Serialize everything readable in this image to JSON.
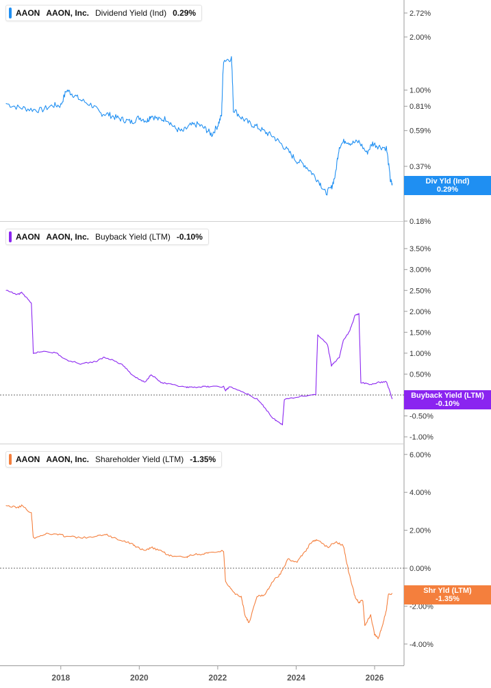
{
  "colors": {
    "div": "#1f8ff2",
    "buyback": "#8a24f0",
    "shareholder": "#f47f3d",
    "grid": "#d0d0d0",
    "axis": "#999999"
  },
  "panels": [
    {
      "ticker": "AAON",
      "company": "AAON, Inc.",
      "metric": "Dividend Yield (Ind)",
      "value": "0.29%",
      "badge_line1": "Div Yld (Ind)",
      "badge_line2": "0.29%"
    },
    {
      "ticker": "AAON",
      "company": "AAON, Inc.",
      "metric": "Buyback Yield (LTM)",
      "value": "-0.10%",
      "badge_line1": "Buyback Yield (LTM)",
      "badge_line2": "-0.10%"
    },
    {
      "ticker": "AAON",
      "company": "AAON, Inc.",
      "metric": "Shareholder Yield (LTM)",
      "value": "-1.35%",
      "badge_line1": "Shr Yld (LTM)",
      "badge_line2": "-1.35%"
    }
  ],
  "x_ticks": [
    "2018",
    "2020",
    "2022",
    "2024",
    "2026"
  ],
  "chart_data": [
    {
      "type": "line",
      "series": [
        {
          "name": "Dividend Yield (Ind)",
          "color": "#1f8ff2"
        }
      ],
      "y_scale": "log",
      "y_ticks": [
        "2.72%",
        "2.00%",
        "1.00%",
        "0.81%",
        "0.59%",
        "0.37%",
        "0.18%"
      ],
      "ylim": [
        0.18,
        2.72
      ],
      "points": [
        [
          2016.6,
          0.84
        ],
        [
          2016.9,
          0.8
        ],
        [
          2017.2,
          0.78
        ],
        [
          2017.5,
          0.77
        ],
        [
          2017.8,
          0.82
        ],
        [
          2018.0,
          0.82
        ],
        [
          2018.15,
          1.0
        ],
        [
          2018.3,
          0.95
        ],
        [
          2018.5,
          0.88
        ],
        [
          2018.8,
          0.82
        ],
        [
          2019.0,
          0.74
        ],
        [
          2019.2,
          0.73
        ],
        [
          2019.4,
          0.7
        ],
        [
          2019.6,
          0.68
        ],
        [
          2019.8,
          0.66
        ],
        [
          2020.0,
          0.7
        ],
        [
          2020.2,
          0.67
        ],
        [
          2020.3,
          0.72
        ],
        [
          2020.5,
          0.68
        ],
        [
          2020.7,
          0.69
        ],
        [
          2020.9,
          0.61
        ],
        [
          2021.1,
          0.58
        ],
        [
          2021.3,
          0.63
        ],
        [
          2021.5,
          0.64
        ],
        [
          2021.7,
          0.6
        ],
        [
          2021.85,
          0.56
        ],
        [
          2022.0,
          0.63
        ],
        [
          2022.1,
          0.72
        ],
        [
          2022.15,
          1.47
        ],
        [
          2022.35,
          1.52
        ],
        [
          2022.4,
          0.78
        ],
        [
          2022.6,
          0.7
        ],
        [
          2022.8,
          0.65
        ],
        [
          2023.0,
          0.62
        ],
        [
          2023.2,
          0.58
        ],
        [
          2023.4,
          0.55
        ],
        [
          2023.6,
          0.5
        ],
        [
          2023.8,
          0.45
        ],
        [
          2024.0,
          0.4
        ],
        [
          2024.2,
          0.38
        ],
        [
          2024.4,
          0.34
        ],
        [
          2024.6,
          0.3
        ],
        [
          2024.75,
          0.26
        ],
        [
          2024.9,
          0.28
        ],
        [
          2025.0,
          0.33
        ],
        [
          2025.1,
          0.48
        ],
        [
          2025.25,
          0.52
        ],
        [
          2025.4,
          0.5
        ],
        [
          2025.6,
          0.51
        ],
        [
          2025.8,
          0.44
        ],
        [
          2025.95,
          0.5
        ],
        [
          2026.1,
          0.48
        ],
        [
          2026.3,
          0.47
        ],
        [
          2026.4,
          0.31
        ],
        [
          2026.45,
          0.29
        ]
      ]
    },
    {
      "type": "line",
      "series": [
        {
          "name": "Buyback Yield (LTM)",
          "color": "#8a24f0"
        }
      ],
      "y_ticks": [
        "3.50%",
        "3.00%",
        "2.50%",
        "2.00%",
        "1.50%",
        "1.00%",
        "0.50%",
        "-0.50%",
        "-1.00%"
      ],
      "ylim": [
        -1.0,
        3.5
      ],
      "points": [
        [
          2016.6,
          2.5
        ],
        [
          2016.9,
          2.4
        ],
        [
          2017.0,
          2.45
        ],
        [
          2017.25,
          2.2
        ],
        [
          2017.3,
          1.0
        ],
        [
          2017.6,
          1.05
        ],
        [
          2017.9,
          1.0
        ],
        [
          2018.1,
          0.85
        ],
        [
          2018.5,
          0.75
        ],
        [
          2018.9,
          0.8
        ],
        [
          2019.1,
          0.9
        ],
        [
          2019.3,
          0.85
        ],
        [
          2019.6,
          0.7
        ],
        [
          2019.8,
          0.5
        ],
        [
          2019.95,
          0.4
        ],
        [
          2020.15,
          0.3
        ],
        [
          2020.3,
          0.5
        ],
        [
          2020.55,
          0.3
        ],
        [
          2020.8,
          0.25
        ],
        [
          2021.2,
          0.18
        ],
        [
          2021.3,
          0.18
        ],
        [
          2021.6,
          0.2
        ],
        [
          2021.8,
          0.2
        ],
        [
          2022.15,
          0.2
        ],
        [
          2022.2,
          0.1
        ],
        [
          2022.3,
          0.2
        ],
        [
          2022.7,
          0.05
        ],
        [
          2023.0,
          -0.1
        ],
        [
          2023.2,
          -0.3
        ],
        [
          2023.4,
          -0.55
        ],
        [
          2023.55,
          -0.65
        ],
        [
          2023.65,
          -0.7
        ],
        [
          2023.7,
          -0.1
        ],
        [
          2024.0,
          -0.05
        ],
        [
          2024.5,
          0.02
        ],
        [
          2024.55,
          1.45
        ],
        [
          2024.8,
          1.2
        ],
        [
          2024.9,
          0.7
        ],
        [
          2025.1,
          0.9
        ],
        [
          2025.2,
          1.3
        ],
        [
          2025.35,
          1.5
        ],
        [
          2025.5,
          1.9
        ],
        [
          2025.6,
          1.95
        ],
        [
          2025.65,
          0.3
        ],
        [
          2025.9,
          0.25
        ],
        [
          2026.1,
          0.3
        ],
        [
          2026.3,
          0.32
        ],
        [
          2026.4,
          0.05
        ],
        [
          2026.45,
          -0.1
        ]
      ]
    },
    {
      "type": "line",
      "series": [
        {
          "name": "Shareholder Yield (LTM)",
          "color": "#f47f3d"
        }
      ],
      "y_ticks": [
        "6.00%",
        "4.00%",
        "2.00%",
        "0.00%",
        "-2.00%",
        "-4.00%"
      ],
      "ylim": [
        -4.0,
        6.0
      ],
      "points": [
        [
          2016.6,
          3.3
        ],
        [
          2016.9,
          3.2
        ],
        [
          2017.0,
          3.3
        ],
        [
          2017.25,
          2.9
        ],
        [
          2017.3,
          1.6
        ],
        [
          2017.6,
          1.8
        ],
        [
          2017.9,
          1.8
        ],
        [
          2018.1,
          1.7
        ],
        [
          2018.5,
          1.6
        ],
        [
          2018.9,
          1.65
        ],
        [
          2019.1,
          1.8
        ],
        [
          2019.3,
          1.65
        ],
        [
          2019.6,
          1.45
        ],
        [
          2019.8,
          1.3
        ],
        [
          2019.95,
          1.1
        ],
        [
          2020.15,
          0.9
        ],
        [
          2020.3,
          1.1
        ],
        [
          2020.55,
          0.9
        ],
        [
          2020.8,
          0.65
        ],
        [
          2021.2,
          0.55
        ],
        [
          2021.3,
          0.7
        ],
        [
          2021.6,
          0.75
        ],
        [
          2021.8,
          0.8
        ],
        [
          2022.15,
          0.9
        ],
        [
          2022.2,
          -0.7
        ],
        [
          2022.4,
          -1.3
        ],
        [
          2022.6,
          -1.5
        ],
        [
          2022.7,
          -2.5
        ],
        [
          2022.8,
          -2.9
        ],
        [
          2023.0,
          -1.5
        ],
        [
          2023.2,
          -1.4
        ],
        [
          2023.4,
          -0.7
        ],
        [
          2023.6,
          -0.3
        ],
        [
          2023.8,
          0.5
        ],
        [
          2024.0,
          0.3
        ],
        [
          2024.2,
          0.8
        ],
        [
          2024.4,
          1.4
        ],
        [
          2024.55,
          1.5
        ],
        [
          2024.8,
          1.1
        ],
        [
          2025.0,
          1.4
        ],
        [
          2025.2,
          1.2
        ],
        [
          2025.35,
          -0.3
        ],
        [
          2025.5,
          -1.5
        ],
        [
          2025.6,
          -1.8
        ],
        [
          2025.7,
          -1.7
        ],
        [
          2025.75,
          -3.0
        ],
        [
          2025.9,
          -2.5
        ],
        [
          2026.0,
          -3.5
        ],
        [
          2026.1,
          -3.7
        ],
        [
          2026.2,
          -3.0
        ],
        [
          2026.3,
          -2.2
        ],
        [
          2026.35,
          -1.4
        ],
        [
          2026.45,
          -1.35
        ]
      ]
    }
  ]
}
